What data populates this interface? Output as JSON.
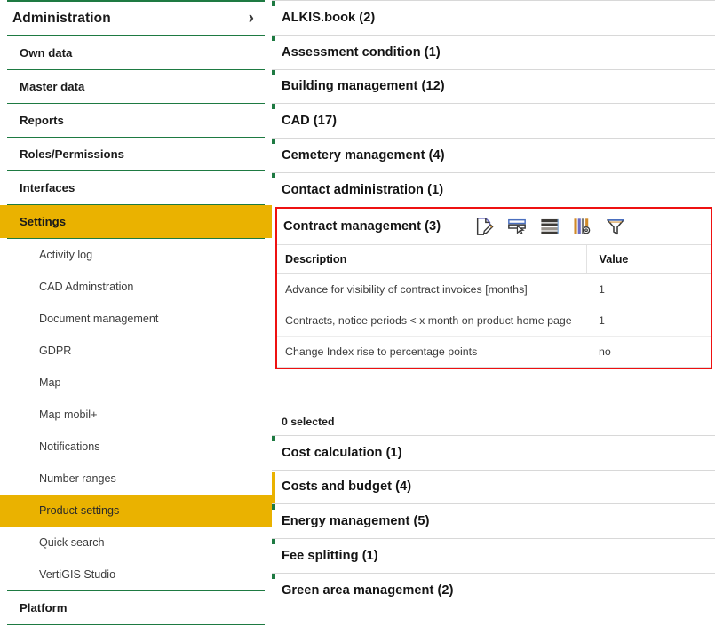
{
  "colors": {
    "accent_green": "#1e7a42",
    "accent_yellow": "#eab200",
    "highlight_red": "#ee1111",
    "text": "#141414"
  },
  "sidebar": {
    "header": {
      "title": "Administration",
      "chevron": "›",
      "chevron_icon": "chevron-right-icon"
    },
    "items": [
      {
        "label": "Own data",
        "level": "top",
        "selected": false
      },
      {
        "label": "Master data",
        "level": "top",
        "selected": false
      },
      {
        "label": "Reports",
        "level": "top",
        "selected": false
      },
      {
        "label": "Roles/Permissions",
        "level": "top",
        "selected": false
      },
      {
        "label": "Interfaces",
        "level": "top",
        "selected": false
      },
      {
        "label": "Settings",
        "level": "top",
        "selected": true
      },
      {
        "label": "Activity log",
        "level": "sub",
        "selected": false
      },
      {
        "label": "CAD Adminstration",
        "level": "sub",
        "selected": false
      },
      {
        "label": "Document management",
        "level": "sub",
        "selected": false
      },
      {
        "label": "GDPR",
        "level": "sub",
        "selected": false
      },
      {
        "label": "Map",
        "level": "sub",
        "selected": false
      },
      {
        "label": "Map mobil+",
        "level": "sub",
        "selected": false
      },
      {
        "label": "Notifications",
        "level": "sub",
        "selected": false
      },
      {
        "label": "Number ranges",
        "level": "sub",
        "selected": false
      },
      {
        "label": "Product settings",
        "level": "sub",
        "selected": true
      },
      {
        "label": "Quick search",
        "level": "sub",
        "selected": false
      },
      {
        "label": "VertiGIS Studio",
        "level": "sub",
        "selected": false
      },
      {
        "label": "Platform",
        "level": "top",
        "selected": false
      }
    ]
  },
  "main": {
    "groups_top": [
      {
        "label": "ALKIS.book (2)"
      },
      {
        "label": "Assessment condition (1)"
      },
      {
        "label": "Building management (12)"
      },
      {
        "label": "CAD (17)"
      },
      {
        "label": "Cemetery management (4)"
      },
      {
        "label": "Contact administration (1)"
      }
    ],
    "expanded_group": {
      "label": "Contract management (3)",
      "toolbar": [
        {
          "name": "edit-document-icon",
          "title": "Edit"
        },
        {
          "name": "select-row-icon",
          "title": "Select row"
        },
        {
          "name": "select-all-rows-icon",
          "title": "Select all"
        },
        {
          "name": "column-settings-icon",
          "title": "Column settings"
        },
        {
          "name": "filter-icon",
          "title": "Filter"
        }
      ],
      "table": {
        "columns": [
          "Description",
          "Value"
        ],
        "rows": [
          {
            "description": "Advance for visibility of contract invoices [months]",
            "value": "1"
          },
          {
            "description": "Contracts, notice periods < x month on product home page",
            "value": "1"
          },
          {
            "description": "Change Index rise to percentage points",
            "value": "no"
          }
        ]
      }
    },
    "selected_count": "0 selected",
    "groups_bottom": [
      {
        "label": "Cost calculation (1)"
      },
      {
        "label": "Costs and budget (4)"
      },
      {
        "label": "Energy management (5)"
      },
      {
        "label": "Fee splitting (1)"
      },
      {
        "label": "Green area management (2)"
      }
    ]
  }
}
